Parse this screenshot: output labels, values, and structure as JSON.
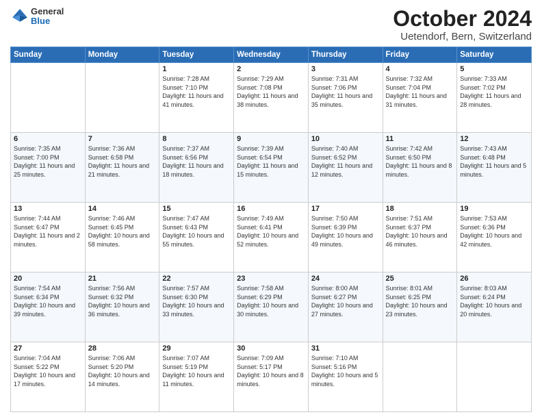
{
  "header": {
    "logo_general": "General",
    "logo_blue": "Blue",
    "title": "October 2024",
    "location": "Uetendorf, Bern, Switzerland"
  },
  "weekdays": [
    "Sunday",
    "Monday",
    "Tuesday",
    "Wednesday",
    "Thursday",
    "Friday",
    "Saturday"
  ],
  "weeks": [
    [
      {
        "day": "",
        "text": ""
      },
      {
        "day": "",
        "text": ""
      },
      {
        "day": "1",
        "text": "Sunrise: 7:28 AM\nSunset: 7:10 PM\nDaylight: 11 hours and 41 minutes."
      },
      {
        "day": "2",
        "text": "Sunrise: 7:29 AM\nSunset: 7:08 PM\nDaylight: 11 hours and 38 minutes."
      },
      {
        "day": "3",
        "text": "Sunrise: 7:31 AM\nSunset: 7:06 PM\nDaylight: 11 hours and 35 minutes."
      },
      {
        "day": "4",
        "text": "Sunrise: 7:32 AM\nSunset: 7:04 PM\nDaylight: 11 hours and 31 minutes."
      },
      {
        "day": "5",
        "text": "Sunrise: 7:33 AM\nSunset: 7:02 PM\nDaylight: 11 hours and 28 minutes."
      }
    ],
    [
      {
        "day": "6",
        "text": "Sunrise: 7:35 AM\nSunset: 7:00 PM\nDaylight: 11 hours and 25 minutes."
      },
      {
        "day": "7",
        "text": "Sunrise: 7:36 AM\nSunset: 6:58 PM\nDaylight: 11 hours and 21 minutes."
      },
      {
        "day": "8",
        "text": "Sunrise: 7:37 AM\nSunset: 6:56 PM\nDaylight: 11 hours and 18 minutes."
      },
      {
        "day": "9",
        "text": "Sunrise: 7:39 AM\nSunset: 6:54 PM\nDaylight: 11 hours and 15 minutes."
      },
      {
        "day": "10",
        "text": "Sunrise: 7:40 AM\nSunset: 6:52 PM\nDaylight: 11 hours and 12 minutes."
      },
      {
        "day": "11",
        "text": "Sunrise: 7:42 AM\nSunset: 6:50 PM\nDaylight: 11 hours and 8 minutes."
      },
      {
        "day": "12",
        "text": "Sunrise: 7:43 AM\nSunset: 6:48 PM\nDaylight: 11 hours and 5 minutes."
      }
    ],
    [
      {
        "day": "13",
        "text": "Sunrise: 7:44 AM\nSunset: 6:47 PM\nDaylight: 11 hours and 2 minutes."
      },
      {
        "day": "14",
        "text": "Sunrise: 7:46 AM\nSunset: 6:45 PM\nDaylight: 10 hours and 58 minutes."
      },
      {
        "day": "15",
        "text": "Sunrise: 7:47 AM\nSunset: 6:43 PM\nDaylight: 10 hours and 55 minutes."
      },
      {
        "day": "16",
        "text": "Sunrise: 7:49 AM\nSunset: 6:41 PM\nDaylight: 10 hours and 52 minutes."
      },
      {
        "day": "17",
        "text": "Sunrise: 7:50 AM\nSunset: 6:39 PM\nDaylight: 10 hours and 49 minutes."
      },
      {
        "day": "18",
        "text": "Sunrise: 7:51 AM\nSunset: 6:37 PM\nDaylight: 10 hours and 46 minutes."
      },
      {
        "day": "19",
        "text": "Sunrise: 7:53 AM\nSunset: 6:36 PM\nDaylight: 10 hours and 42 minutes."
      }
    ],
    [
      {
        "day": "20",
        "text": "Sunrise: 7:54 AM\nSunset: 6:34 PM\nDaylight: 10 hours and 39 minutes."
      },
      {
        "day": "21",
        "text": "Sunrise: 7:56 AM\nSunset: 6:32 PM\nDaylight: 10 hours and 36 minutes."
      },
      {
        "day": "22",
        "text": "Sunrise: 7:57 AM\nSunset: 6:30 PM\nDaylight: 10 hours and 33 minutes."
      },
      {
        "day": "23",
        "text": "Sunrise: 7:58 AM\nSunset: 6:29 PM\nDaylight: 10 hours and 30 minutes."
      },
      {
        "day": "24",
        "text": "Sunrise: 8:00 AM\nSunset: 6:27 PM\nDaylight: 10 hours and 27 minutes."
      },
      {
        "day": "25",
        "text": "Sunrise: 8:01 AM\nSunset: 6:25 PM\nDaylight: 10 hours and 23 minutes."
      },
      {
        "day": "26",
        "text": "Sunrise: 8:03 AM\nSunset: 6:24 PM\nDaylight: 10 hours and 20 minutes."
      }
    ],
    [
      {
        "day": "27",
        "text": "Sunrise: 7:04 AM\nSunset: 5:22 PM\nDaylight: 10 hours and 17 minutes."
      },
      {
        "day": "28",
        "text": "Sunrise: 7:06 AM\nSunset: 5:20 PM\nDaylight: 10 hours and 14 minutes."
      },
      {
        "day": "29",
        "text": "Sunrise: 7:07 AM\nSunset: 5:19 PM\nDaylight: 10 hours and 11 minutes."
      },
      {
        "day": "30",
        "text": "Sunrise: 7:09 AM\nSunset: 5:17 PM\nDaylight: 10 hours and 8 minutes."
      },
      {
        "day": "31",
        "text": "Sunrise: 7:10 AM\nSunset: 5:16 PM\nDaylight: 10 hours and 5 minutes."
      },
      {
        "day": "",
        "text": ""
      },
      {
        "day": "",
        "text": ""
      }
    ]
  ]
}
